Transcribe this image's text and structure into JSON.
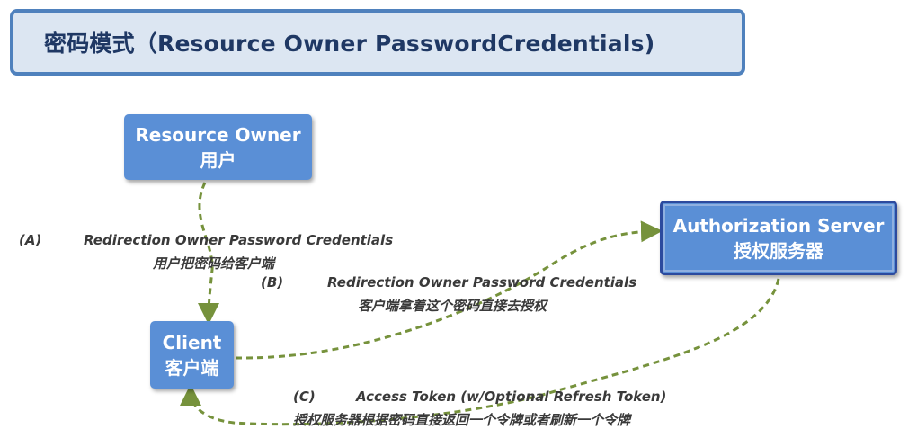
{
  "title": "密码模式（Resource Owner PasswordCredentials)",
  "nodes": {
    "resource_owner": {
      "en": "Resource Owner",
      "cn": "用户"
    },
    "authorization_server": {
      "en": "Authorization Server",
      "cn": "授权服务器"
    },
    "client": {
      "en": "Client",
      "cn": "客户端"
    }
  },
  "steps": {
    "a": {
      "tag": "(A)",
      "en": "Redirection Owner Password Credentials",
      "cn": "用户把密码给客户端"
    },
    "b": {
      "tag": "(B)",
      "en": "Redirection Owner Password Credentials",
      "cn": "客户端拿着这个密码直接去授权"
    },
    "c": {
      "tag": "(C)",
      "en": "Access Token (w/Optional Refresh Token)",
      "cn": "授权服务器根据密码直接返回一个令牌或者刷新一个令牌"
    }
  },
  "colors": {
    "node_fill": "#5a8fd6",
    "title_border": "#4f81bd",
    "title_fill": "#dce6f2",
    "arrow": "#76923c"
  }
}
